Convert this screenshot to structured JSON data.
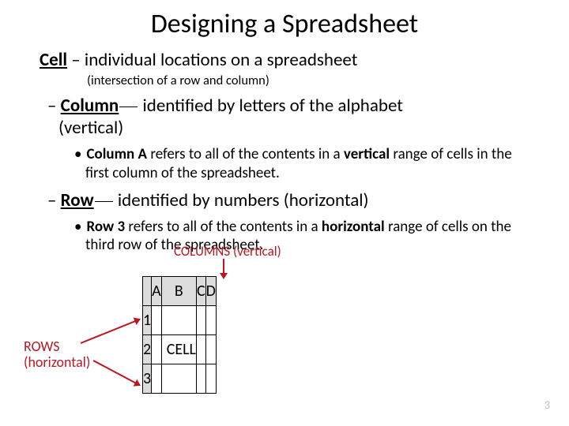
{
  "title": "Designing a Spreadsheet",
  "cell": {
    "term": "Cell",
    "def": " – individual locations on a spreadsheet",
    "sub": "(intersection of a row and column)"
  },
  "column": {
    "dash": "–",
    "term": "Column",
    "def_a": " identified by letters of the alphabet",
    "def_b": "(vertical)",
    "bullet_pre": "Column A",
    "bullet_mid": " refers to all of the contents in a ",
    "bullet_bold": "vertical",
    "bullet_post": " range of cells in the first column of the spreadsheet."
  },
  "row": {
    "dash": "–",
    "term": "Row",
    "def": " identified by numbers (horizontal)",
    "bullet_pre": "Row 3",
    "bullet_mid": " refers to all of the contents in a ",
    "bullet_bold": "horizontal",
    "bullet_post": " range of cells on the third row of the spreadsheet."
  },
  "diagram": {
    "cols_label": "COLUMNS  (vertical)",
    "rows_label_a": "ROWS",
    "rows_label_b": "(horizontal)",
    "cell_label": "CELL",
    "columns": [
      "A",
      "B",
      "C",
      "D"
    ],
    "rows": [
      "1",
      "2",
      "3"
    ]
  },
  "page_number": "3"
}
